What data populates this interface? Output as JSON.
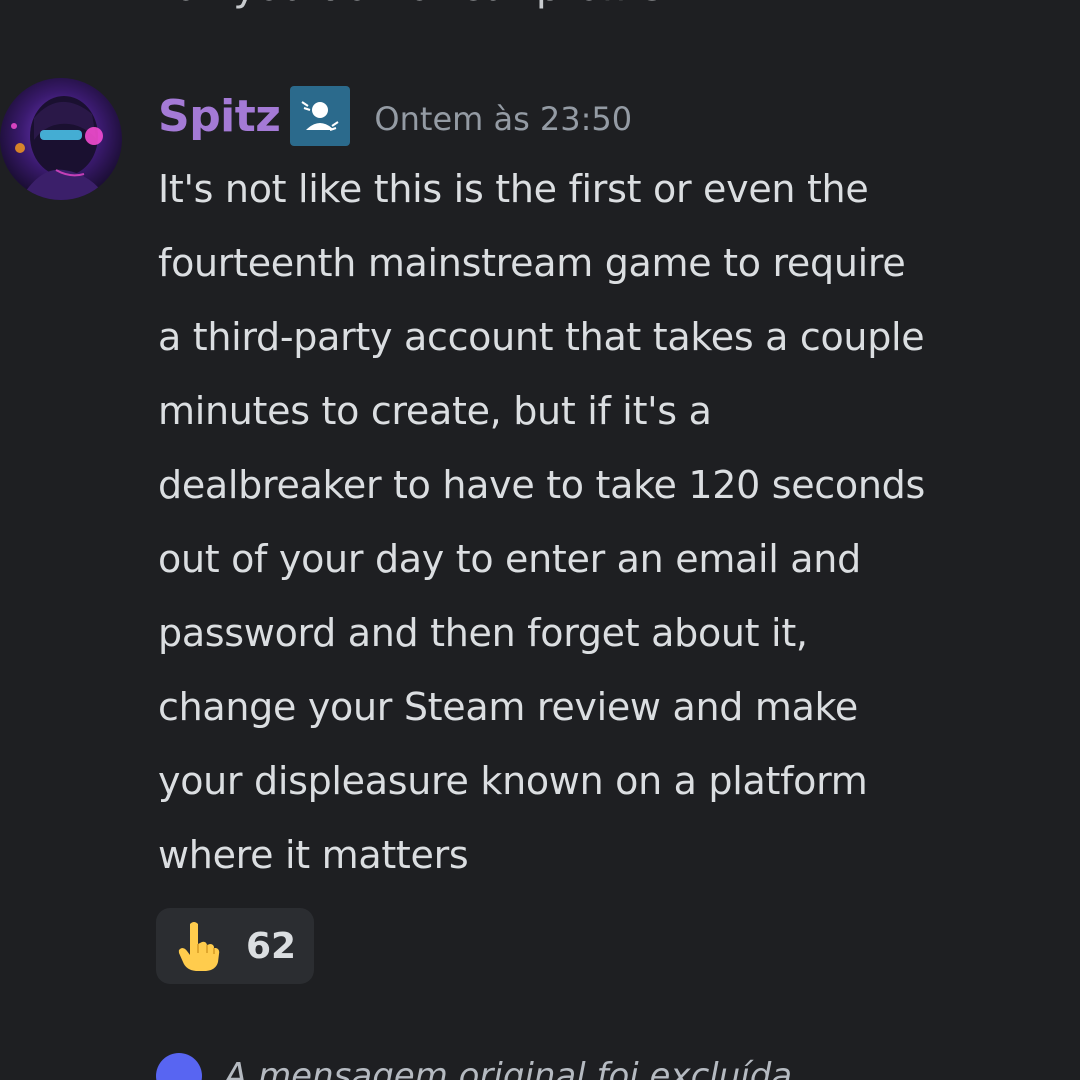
{
  "previous_message": {
    "text": "toil you do not cut profits"
  },
  "message": {
    "author": "Spitz",
    "timestamp": "Ontem às 23:50",
    "lines": [
      "It's not like this is the first or even the",
      "fourteenth mainstream game to require",
      "a third-party account that takes a couple",
      "minutes to create, but if it's a",
      "dealbreaker to have to take 120 seconds",
      "out of your day to enter an email and",
      "password and then forget about it,",
      "change your Steam review and make",
      "your displeasure known on a platform",
      "where it matters"
    ],
    "reaction": {
      "emoji": "pointing-up-hand-icon",
      "count": "62"
    }
  },
  "next_reply": {
    "text": "A mensagem original foi excluída"
  },
  "colors": {
    "background": "#1e1f22",
    "username": "#a47ad6",
    "text": "#dbdee1",
    "muted": "#949ba4",
    "reaction_bg": "#2b2d31",
    "badge_bg": "#2b6a8c"
  }
}
